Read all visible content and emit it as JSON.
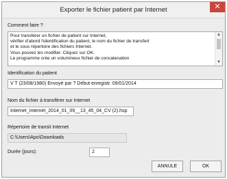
{
  "window": {
    "title": "Exporter le fichier patient par Internet",
    "close_glyph": "✕"
  },
  "comment": {
    "label": "Comment faire ?",
    "lines": [
      "Pour transférer un fichier de patient sur Internet,",
      "vérifier d'abord l'identification du patient, le nom du fichier de transfert",
      "et le sous répertoire des fichiers Internet.",
      "Vous pouvez les modifier. Cliquez sur OK.",
      "Le programme crée un volumineux fichier de concatenation"
    ]
  },
  "patient": {
    "label": "Identification du patient",
    "value": "V T (23/08/1980) Envoyé par ? Début enregistr. 09/01/2014"
  },
  "file": {
    "label": "Nom du fichier à transférer sur Internet",
    "value": "Internet_Internet_2014_01_09__13_45_04_CV (2).hsp"
  },
  "directory": {
    "label": "Répertoire de transit Internet",
    "value": "C:\\Users\\Apo\\Downloads"
  },
  "duration": {
    "label": "Durée (jours):",
    "value": "2"
  },
  "buttons": {
    "cancel": "ANNULE",
    "ok": "OK"
  },
  "scrollbar": {
    "up_glyph": "▲",
    "down_glyph": "▼"
  }
}
